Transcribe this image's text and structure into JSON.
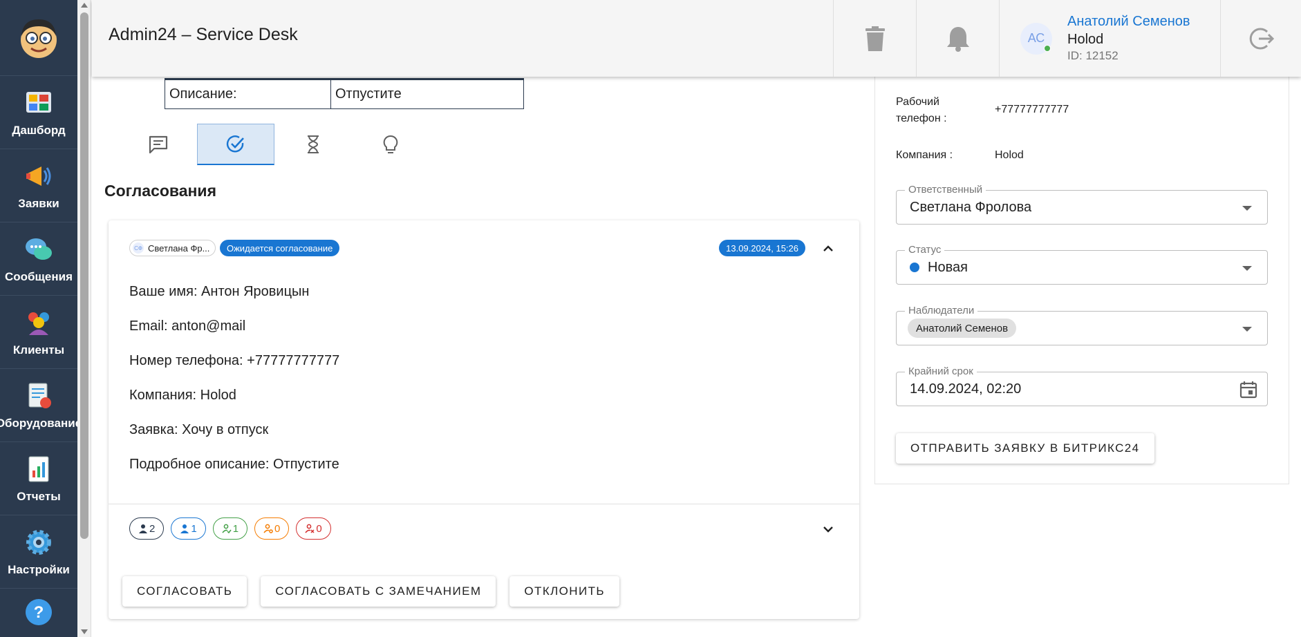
{
  "header": {
    "app_title": "Admin24 – Service Desk",
    "user": {
      "initials": "АС",
      "name": "Анатолий Семенов",
      "company": "Holod",
      "id_text": "ID: 12152"
    }
  },
  "nav": {
    "items": [
      {
        "label": "Дашборд",
        "icon": "dashboard-icon"
      },
      {
        "label": "Заявки",
        "icon": "megaphone-icon"
      },
      {
        "label": "Сообщения",
        "icon": "chat-bubbles-icon"
      },
      {
        "label": "Клиенты",
        "icon": "people-icon"
      },
      {
        "label": "Оборудование",
        "icon": "equipment-icon"
      },
      {
        "label": "Отчеты",
        "icon": "report-icon"
      },
      {
        "label": "Настройки",
        "icon": "gear-icon"
      }
    ],
    "help_icon": "help-icon"
  },
  "ticket": {
    "description_label": "Описание:",
    "description_value": "Отпустите"
  },
  "tabs": [
    {
      "icon": "comments-icon",
      "active": false
    },
    {
      "icon": "approval-check-icon",
      "active": true
    },
    {
      "icon": "hourglass-icon",
      "active": false
    },
    {
      "icon": "lightbulb-icon",
      "active": false
    }
  ],
  "approvals": {
    "title": "Согласования",
    "card": {
      "author_initials": "СФ",
      "author": "Светлана Фр...",
      "status": "Ожидается согласование",
      "date": "13.09.2024, 15:26",
      "lines": [
        "Ваше имя: Антон Яровицын",
        "Email: anton@mail",
        "Номер телефона: +77777777777",
        "Компания: Holod",
        "Заявка: Хочу в отпуск",
        "Подробное описание: Отпустите"
      ],
      "counters": [
        {
          "value": "2",
          "color": "#2b3a4e"
        },
        {
          "value": "1",
          "color": "#1976d2"
        },
        {
          "value": "1",
          "color": "#43a047"
        },
        {
          "value": "0",
          "color": "#f57c00"
        },
        {
          "value": "0",
          "color": "#d32f2f"
        }
      ],
      "actions": {
        "approve": "СОГЛАСОВАТЬ",
        "approve_with_note": "СОГЛАСОВАТЬ С ЗАМЕЧАНИЕМ",
        "reject": "ОТКЛОНИТЬ"
      }
    }
  },
  "side": {
    "work_phone_label": "Рабочий телефон :",
    "work_phone_value": "+77777777777",
    "company_label": "Компания :",
    "company_value": "Holod",
    "responsible": {
      "label": "Ответственный",
      "value": "Светлана Фролова"
    },
    "status": {
      "label": "Статус",
      "value": "Новая",
      "color": "#1976d2"
    },
    "observers": {
      "label": "Наблюдатели",
      "chips": [
        "Анатолий Семенов"
      ]
    },
    "deadline": {
      "label": "Крайний срок",
      "value": "14.09.2024, 02:20"
    },
    "send_button": "ОТПРАВИТЬ ЗАЯВКУ В БИТРИКС24"
  },
  "colors": {
    "nav_bg": "#2b3a4e",
    "accent": "#1976d2",
    "header_bg": "#f5f5f5"
  }
}
